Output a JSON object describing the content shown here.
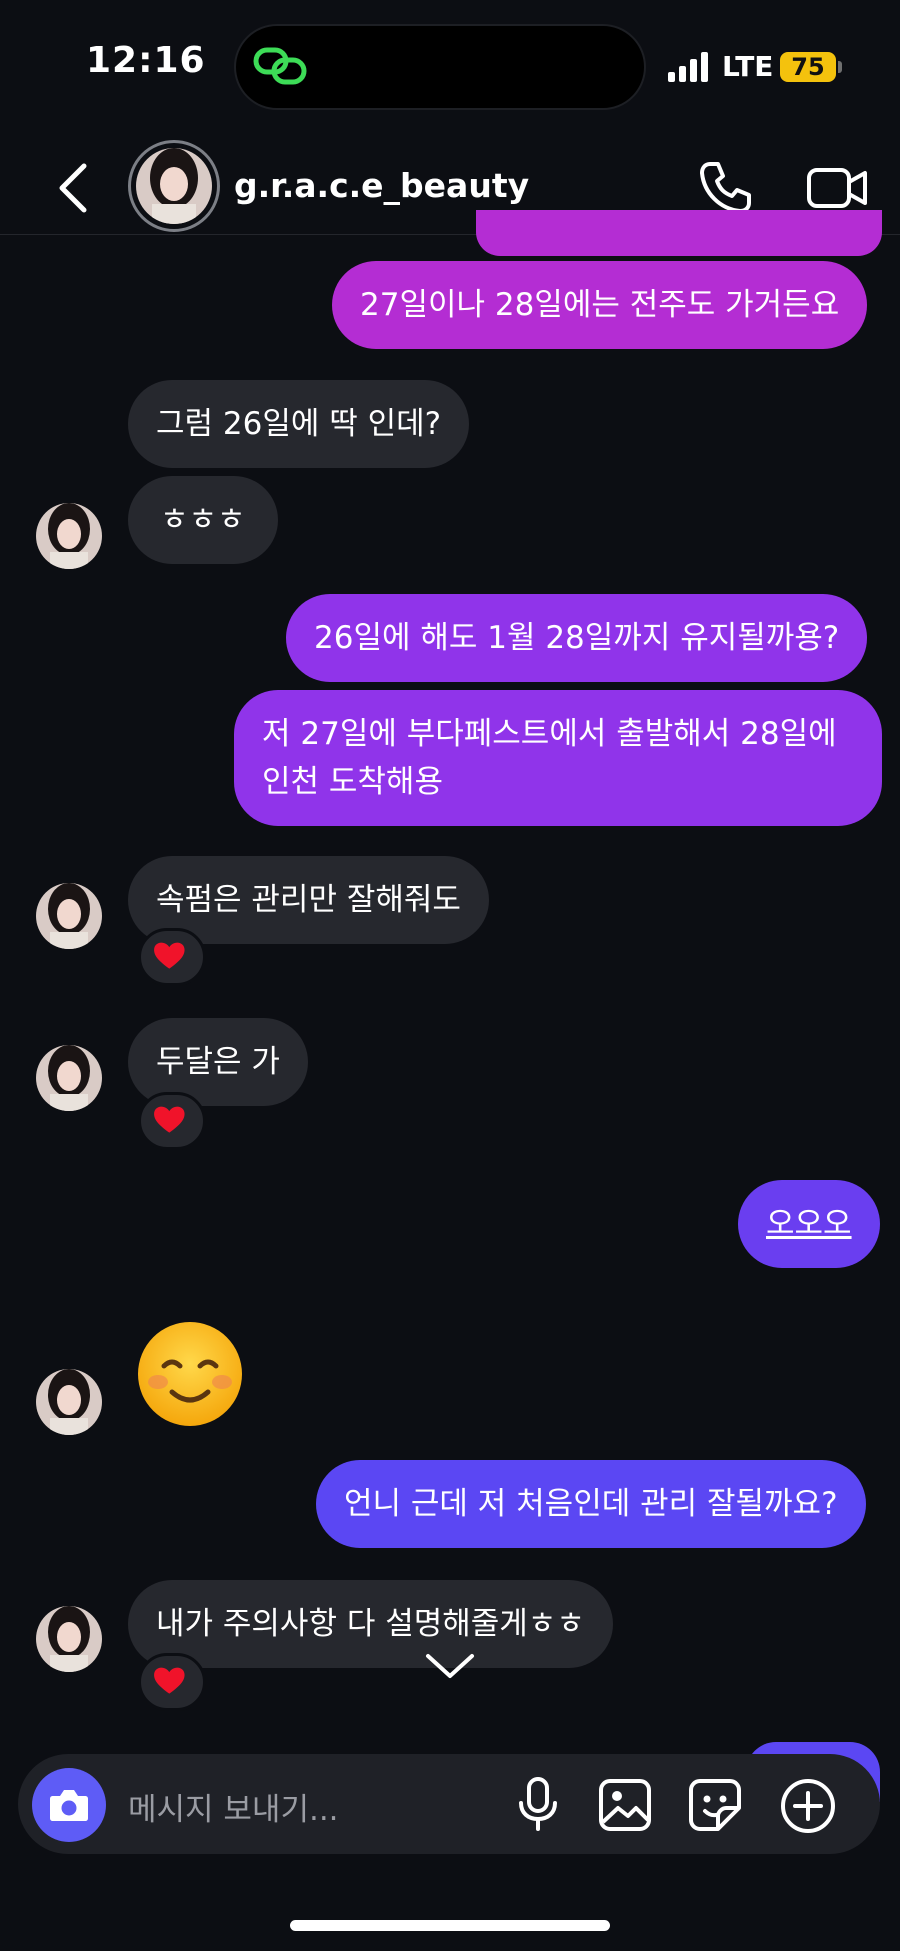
{
  "status_bar": {
    "time": "12:16",
    "network": "LTE",
    "battery": "75",
    "island_icon": "link-rings-icon",
    "island_color": "#3ddc57",
    "battery_color": "#f4c20d"
  },
  "header": {
    "username": "g.r.a.c.e_beauty",
    "back_icon": "chevron-left-icon",
    "call_icon": "phone-icon",
    "video_icon": "video-camera-icon"
  },
  "messages": [
    {
      "side": "out",
      "text": "27일이나 28일에는 전주도 가거든요"
    },
    {
      "side": "in",
      "text": "그럼 26일에 딱 인데?"
    },
    {
      "side": "in",
      "text": "ㅎㅎㅎ"
    },
    {
      "side": "out",
      "text": "26일에 해도 1월 28일까지 유지될까용?"
    },
    {
      "side": "out",
      "text": "저 27일에 부다페스트에서 출발해서 28일에 인천 도착해용"
    },
    {
      "side": "in",
      "text": "속펌은 관리만 잘해줘도",
      "reaction": "❤️"
    },
    {
      "side": "in",
      "text": "두달은 가",
      "reaction": "❤️"
    },
    {
      "side": "out",
      "text": "오오오"
    },
    {
      "side": "in",
      "emoji": "☺️"
    },
    {
      "side": "out",
      "text": "언니 근데 저 처음인데 관리 잘될까요?"
    },
    {
      "side": "in",
      "text": "내가 주의사항 다 설명해줄게ㅎㅎ",
      "reaction": "❤️"
    }
  ],
  "colors": {
    "background": "#0c0e13",
    "incoming_bubble": "#26282e",
    "outgoing_gradient": [
      "#b42dd3",
      "#9034ea",
      "#6a3ef0",
      "#5b47f3"
    ],
    "camera_button": "#5e5cf6"
  },
  "composer": {
    "placeholder": "메시지 보내기...",
    "camera_icon": "camera-icon",
    "mic_icon": "microphone-icon",
    "gallery_icon": "image-icon",
    "sticker_icon": "sticker-icon",
    "plus_icon": "plus-circle-icon"
  },
  "scroll_icon": "chevron-down-icon"
}
